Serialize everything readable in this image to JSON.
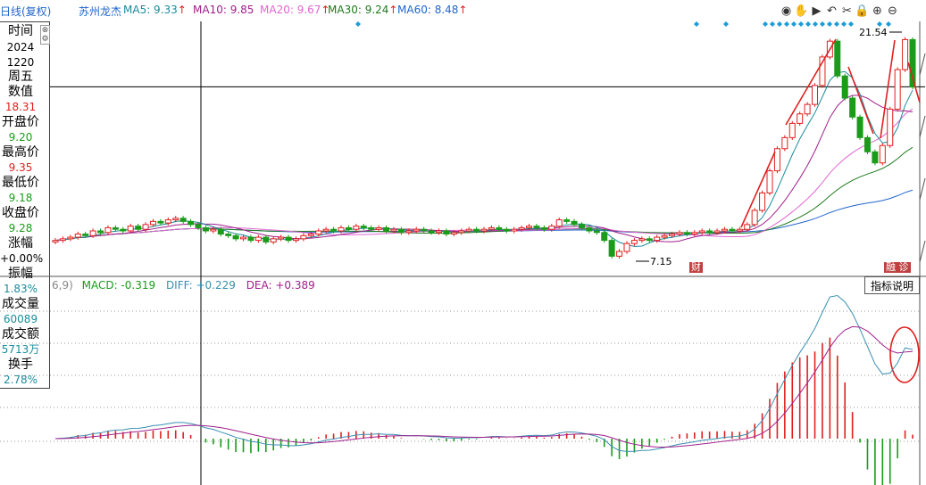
{
  "header": {
    "period": "日线(复权)",
    "stock_name": "苏州龙杰",
    "ma": [
      {
        "label": "MA5: 9.33",
        "color": "#1a8c9c"
      },
      {
        "label": "MA10: 9.85",
        "color": "#a0208c"
      },
      {
        "label": "MA20: 9.67",
        "color": "#e066d2"
      },
      {
        "label": "MA30: 9.24",
        "color": "#1e7a1e"
      },
      {
        "label": "MA60: 8.48",
        "color": "#2266cc"
      }
    ],
    "arrows": [
      "↑",
      "",
      "↑",
      "↑",
      "↑"
    ]
  },
  "toolbar": [
    {
      "name": "eye-icon",
      "glyph": "◉"
    },
    {
      "name": "hand-icon",
      "glyph": "✋"
    },
    {
      "name": "play-icon",
      "glyph": "▶"
    },
    {
      "name": "undo-icon",
      "glyph": "↶"
    },
    {
      "name": "scissors-icon",
      "glyph": "✂"
    },
    {
      "name": "lock-icon",
      "glyph": "🔒"
    },
    {
      "name": "zoom-in-icon",
      "glyph": "⊕"
    },
    {
      "name": "zoom-out-icon",
      "glyph": "⊖"
    }
  ],
  "info": {
    "time_label": "时间",
    "year": "2024",
    "date": "1220",
    "weekday": "周五",
    "value_label": "数值",
    "value": "18.31",
    "open_label": "开盘价",
    "open": "9.20",
    "high_label": "最高价",
    "high": "9.35",
    "low_label": "最低价",
    "low": "9.18",
    "close_label": "收盘价",
    "close": "9.28",
    "change_label": "涨幅",
    "change": "+0.00%",
    "amp_label": "振幅",
    "amp": "1.83%",
    "vol_label": "成交量",
    "vol": "60089",
    "amt_label": "成交额",
    "amt": "5713万",
    "turn_label": "换手",
    "turn": "2.78%"
  },
  "macd": {
    "prefix": "6,9)",
    "macd": "MACD: -0.319",
    "diff": "DIFF: +0.229",
    "dea": "DEA: +0.389",
    "help_button": "指标说明"
  },
  "annotations": {
    "low_price": "7.15",
    "high_price": "21.54",
    "cai_badge": "财",
    "right_badge": "融 诊"
  },
  "colors": {
    "up": "#e02020",
    "down": "#1a9c1a",
    "ma5": "#1a8c9c",
    "ma10": "#a0208c",
    "ma20": "#e066d2",
    "ma30": "#1e7a1e",
    "ma60": "#2266cc",
    "diff": "#3a8fb0",
    "dea": "#a0208c"
  },
  "chart_data": {
    "type": "candlestick",
    "price_range": [
      7.0,
      22.0
    ],
    "cursor_price": 18.31,
    "closes": [
      8.6,
      8.7,
      8.8,
      9.0,
      8.9,
      9.2,
      9.1,
      9.4,
      9.3,
      9.2,
      9.5,
      9.3,
      9.6,
      9.8,
      9.7,
      9.9,
      10.0,
      9.8,
      9.6,
      9.4,
      9.2,
      9.3,
      9.0,
      8.9,
      8.7,
      8.8,
      8.6,
      8.8,
      8.5,
      8.7,
      8.8,
      8.6,
      8.7,
      8.9,
      9.0,
      9.2,
      9.3,
      9.2,
      9.4,
      9.3,
      9.5,
      9.4,
      9.3,
      9.4,
      9.2,
      9.3,
      9.1,
      9.2,
      9.3,
      9.2,
      9.1,
      9.2,
      9.0,
      9.1,
      9.2,
      9.3,
      9.2,
      9.3,
      9.4,
      9.3,
      9.2,
      9.3,
      9.4,
      9.5,
      9.4,
      9.3,
      9.5,
      9.9,
      9.8,
      9.6,
      9.4,
      9.2,
      9.1,
      8.6,
      7.6,
      7.9,
      8.4,
      8.6,
      8.7,
      8.6,
      8.8,
      8.9,
      9.0,
      9.1,
      9.0,
      9.1,
      9.2,
      9.1,
      9.2,
      9.3,
      9.2,
      9.3,
      9.6,
      10.5,
      11.6,
      13.0,
      14.4,
      15.1,
      16.0,
      16.6,
      17.2,
      18.4,
      20.2,
      21.2,
      19.0,
      17.6,
      16.4,
      15.1,
      14.2,
      13.5,
      14.6,
      16.9,
      19.4,
      21.3,
      18.3
    ]
  }
}
